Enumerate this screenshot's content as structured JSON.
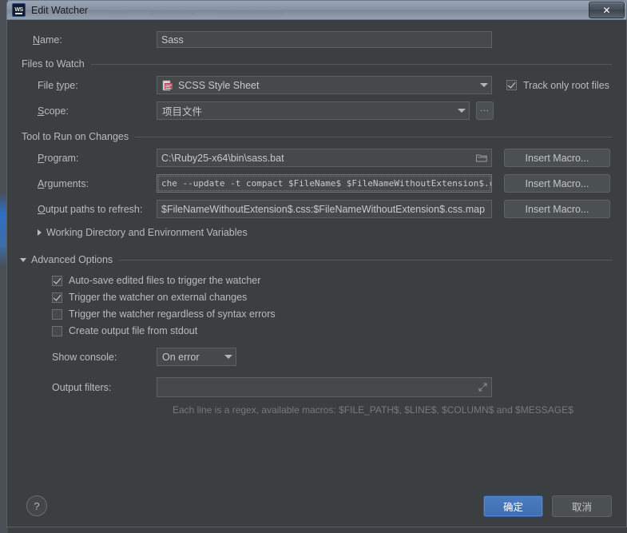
{
  "window": {
    "title": "Edit Watcher",
    "app_icon": "webstorm-logo-icon",
    "close_label": "✕",
    "ghost_tabs": [
      "……",
      "……………",
      "…………………"
    ]
  },
  "name_row": {
    "label": "Name:",
    "label_mnemonic": "N",
    "label_rest": "ame:",
    "value": "Sass"
  },
  "files_to_watch": {
    "group_title": "Files to Watch",
    "file_type": {
      "label_pre": "File ",
      "label_mnemonic": "t",
      "label_post": "ype:",
      "value": "SCSS Style Sheet",
      "icon": "scss-file-icon"
    },
    "scope": {
      "label_mnemonic": "S",
      "label_post": "cope:",
      "value": "项目文件",
      "browse_label": "..."
    },
    "track_only_root_files": {
      "label": "Track only root files",
      "checked": true
    }
  },
  "tool_to_run": {
    "group_title": "Tool to Run on Changes",
    "program": {
      "label_mnemonic": "P",
      "label_post": "rogram:",
      "value": "C:\\Ruby25-x64\\bin\\sass.bat",
      "icon": "folder-browse-icon",
      "insert_macro": "Insert Macro..."
    },
    "arguments": {
      "label_mnemonic": "A",
      "label_post": "rguments:",
      "value": "che --update -t compact $FileName$ $FileNameWithoutExtension$.css",
      "icon": "expand-editor-icon",
      "insert_macro": "Insert Macro..."
    },
    "output_paths": {
      "label_mnemonic": "O",
      "label_post": "utput paths to refresh:",
      "value": "$FileNameWithoutExtension$.css:$FileNameWithoutExtension$.css.map",
      "insert_macro": "Insert Macro..."
    },
    "working_dir_link": {
      "label": "Working Directory and Environment Variables",
      "expanded": false
    }
  },
  "advanced_options": {
    "group_title": "Advanced Options",
    "expanded": true,
    "checkboxes": [
      {
        "label": "Auto-save edited files to trigger the watcher",
        "checked": true
      },
      {
        "label": "Trigger the watcher on external changes",
        "checked": true
      },
      {
        "label": "Trigger the watcher regardless of syntax errors",
        "checked": false
      },
      {
        "label": "Create output file from stdout",
        "checked": false
      }
    ],
    "show_console": {
      "label": "Show console:",
      "value": "On error"
    },
    "output_filters": {
      "label": "Output filters:",
      "value": "",
      "icon": "expand-editor-icon"
    },
    "hint": "Each line is a regex, available macros: $FILE_PATH$, $LINE$, $COLUMN$ and $MESSAGE$"
  },
  "footer": {
    "help_label": "?",
    "ok_label": "确定",
    "cancel_label": "取消"
  },
  "colors": {
    "dialog_bg": "#3c3f41",
    "field_bg": "#45494a",
    "text": "#b9bbbd",
    "accent_blue": "#4b7cc0",
    "titlebar": "#8793a3"
  }
}
